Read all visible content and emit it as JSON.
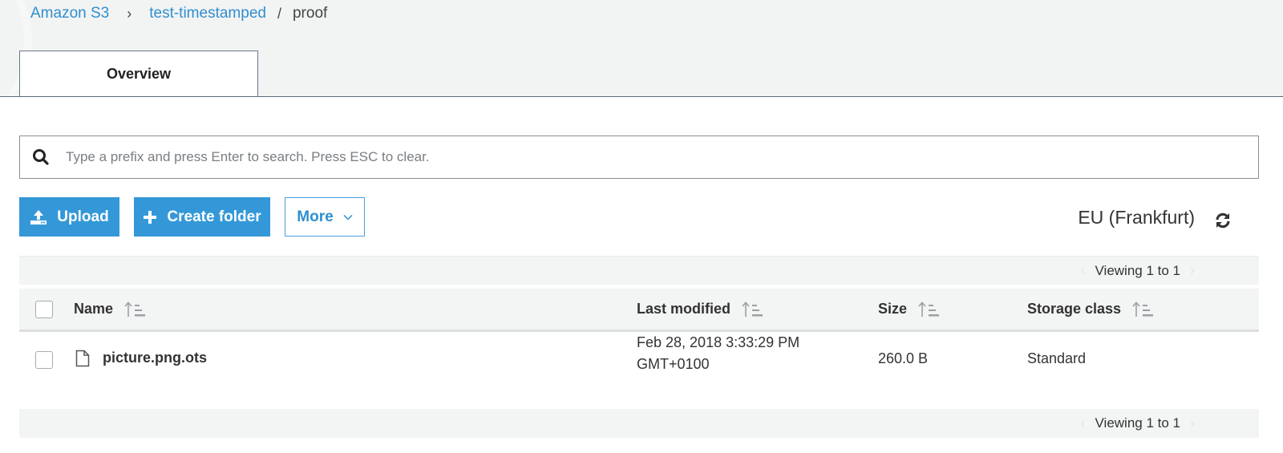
{
  "breadcrumb": {
    "root": "Amazon S3",
    "separator_chevron": "›",
    "bucket": "test-timestamped",
    "separator_slash": "/",
    "current": "proof"
  },
  "tabs": [
    {
      "label": "Overview",
      "active": true
    }
  ],
  "search": {
    "value": "",
    "placeholder": "Type a prefix and press Enter to search. Press ESC to clear.",
    "icon": "search-icon"
  },
  "toolbar": {
    "upload_label": "Upload",
    "upload_icon": "upload-icon",
    "create_folder_label": "Create folder",
    "create_folder_icon": "plus-icon",
    "more_label": "More",
    "more_icon": "chevron-down-icon",
    "region": "EU (Frankfurt)",
    "refresh_icon": "refresh-icon"
  },
  "pagination": {
    "top_label": "Viewing 1 to 1",
    "bottom_label": "Viewing 1 to 1",
    "prev": "‹",
    "next": "›"
  },
  "table": {
    "columns": [
      {
        "label": "Name",
        "sort_icon": "sort-ascending-icon"
      },
      {
        "label": "Last modified",
        "sort_icon": "sort-ascending-icon"
      },
      {
        "label": "Size",
        "sort_icon": "sort-ascending-icon"
      },
      {
        "label": "Storage class",
        "sort_icon": "sort-ascending-icon"
      }
    ],
    "rows": [
      {
        "name": "picture.png.ots",
        "icon": "file-icon",
        "last_modified_line1": "Feb 28, 2018 3:33:29 PM",
        "last_modified_line2": "GMT+0100",
        "size": "260.0 B",
        "storage_class": "Standard",
        "checked": false
      }
    ]
  },
  "colors": {
    "accent": "#3498d8",
    "link": "#2f8fcf",
    "header_bg": "#f2f3f3",
    "table_band": "#f3f4f4"
  }
}
